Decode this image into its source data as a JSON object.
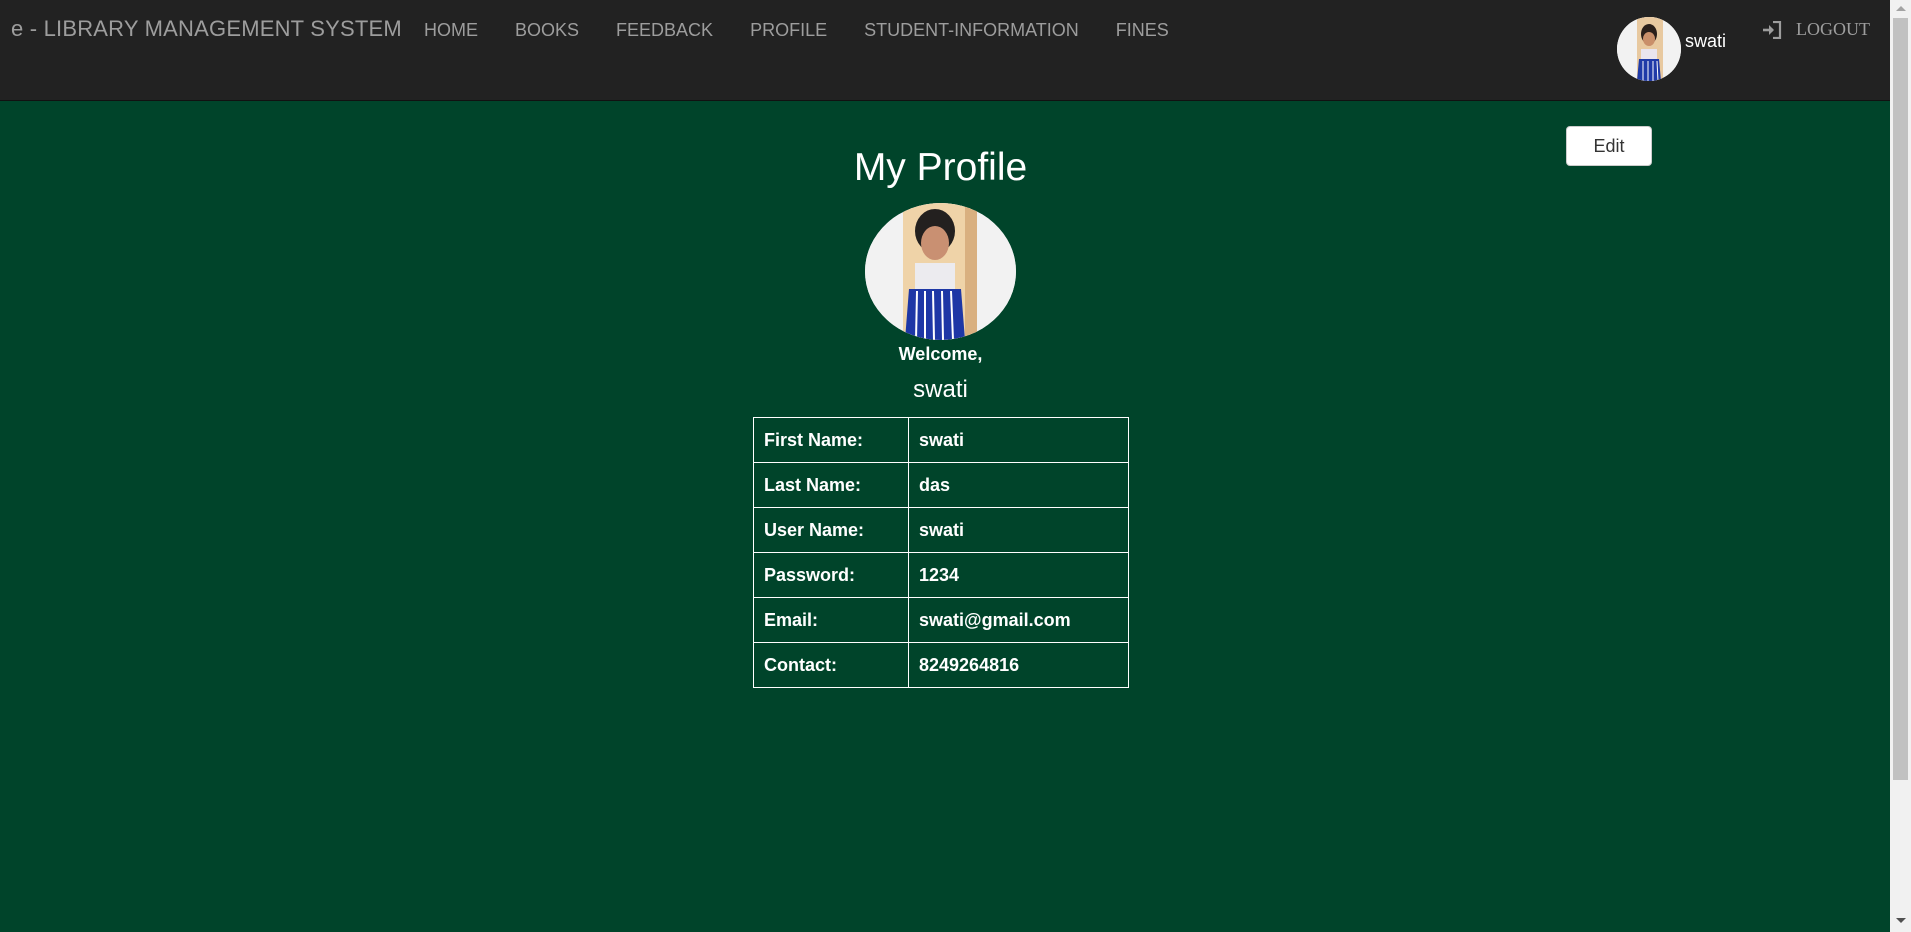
{
  "navbar": {
    "brand": "e - LIBRARY MANAGEMENT SYSTEM",
    "items": [
      {
        "label": "HOME"
      },
      {
        "label": "BOOKS"
      },
      {
        "label": "FEEDBACK"
      },
      {
        "label": "PROFILE"
      },
      {
        "label": "STUDENT-INFORMATION"
      },
      {
        "label": "FINES"
      }
    ],
    "user": {
      "name": "swati",
      "avatar_icon": "user-photo"
    },
    "logout": {
      "label": "LOGOUT",
      "icon": "log-in-icon"
    }
  },
  "profile": {
    "edit_label": "Edit",
    "title": "My Profile",
    "welcome": "Welcome,",
    "welcome_name": "swati",
    "fields": [
      {
        "key": "First Name:",
        "value": "swati"
      },
      {
        "key": "Last Name:",
        "value": "das"
      },
      {
        "key": "User Name:",
        "value": "swati"
      },
      {
        "key": "Password:",
        "value": "1234"
      },
      {
        "key": "Email:",
        "value": "swati@gmail.com"
      },
      {
        "key": "Contact:",
        "value": "8249264816"
      }
    ]
  },
  "colors": {
    "navbar_bg": "#222222",
    "page_bg": "#00442a",
    "nav_text": "#9d9d9d"
  }
}
